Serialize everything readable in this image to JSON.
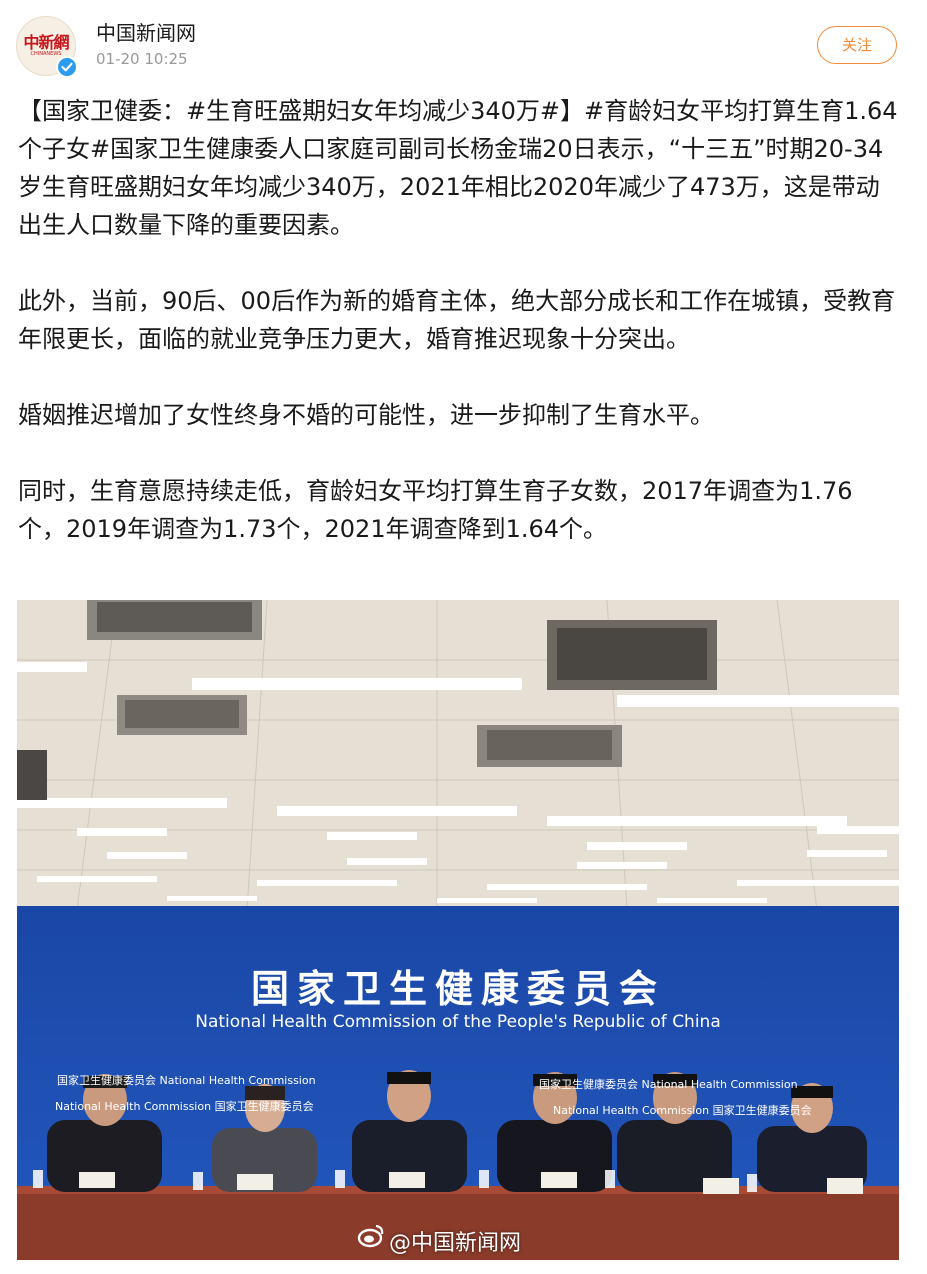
{
  "header": {
    "author": "中国新闻网",
    "time": "01-20 10:25",
    "follow_label": "关注",
    "avatar_logo_text": "中新網",
    "avatar_logo_sub": "CHINANEWS"
  },
  "post": {
    "p1_topic": "【国家卫健委：#生育旺盛期妇女年均减少340万#】#育龄妇女平均打算生育1.64个子女#",
    "p1_text": "国家卫生健康委人口家庭司副司长杨金瑞20日表示，“十三五”时期20-34岁生育旺盛期妇女年均减少340万，2021年相比2020年减少了473万，这是带动出生人口数量下降的重要因素。",
    "p2": "此外，当前，90后、00后作为新的婚育主体，绝大部分成长和工作在城镇，受教育年限更长，面临的就业竞争压力更大，婚育推迟现象十分突出。",
    "p3": "婚姻推迟增加了女性终身不婚的可能性，进一步抑制了生育水平。",
    "p4": "同时，生育意愿持续走低，育龄妇女平均打算生育子女数，2017年调查为1.76个，2019年调查为1.73个，2021年调查降到1.64个。"
  },
  "photo": {
    "banner_title": "国家卫生健康委员会",
    "banner_subtitle": "National Health Commission of the People's Republic of China",
    "sign_left_1": "国家卫生健康委员会  National Health Commission",
    "sign_left_2": "National Health Commission  国家卫生健康委员会",
    "sign_right_1": "国家卫生健康委员会  National Health Commission",
    "sign_right_2": "National Health Commission  国家卫生健康委员会",
    "watermark": "@中国新闻网"
  },
  "colors": {
    "accent_orange": "#f28c3b",
    "verified_blue": "#2c9bf0",
    "backdrop_blue": "#1f4fb3"
  }
}
